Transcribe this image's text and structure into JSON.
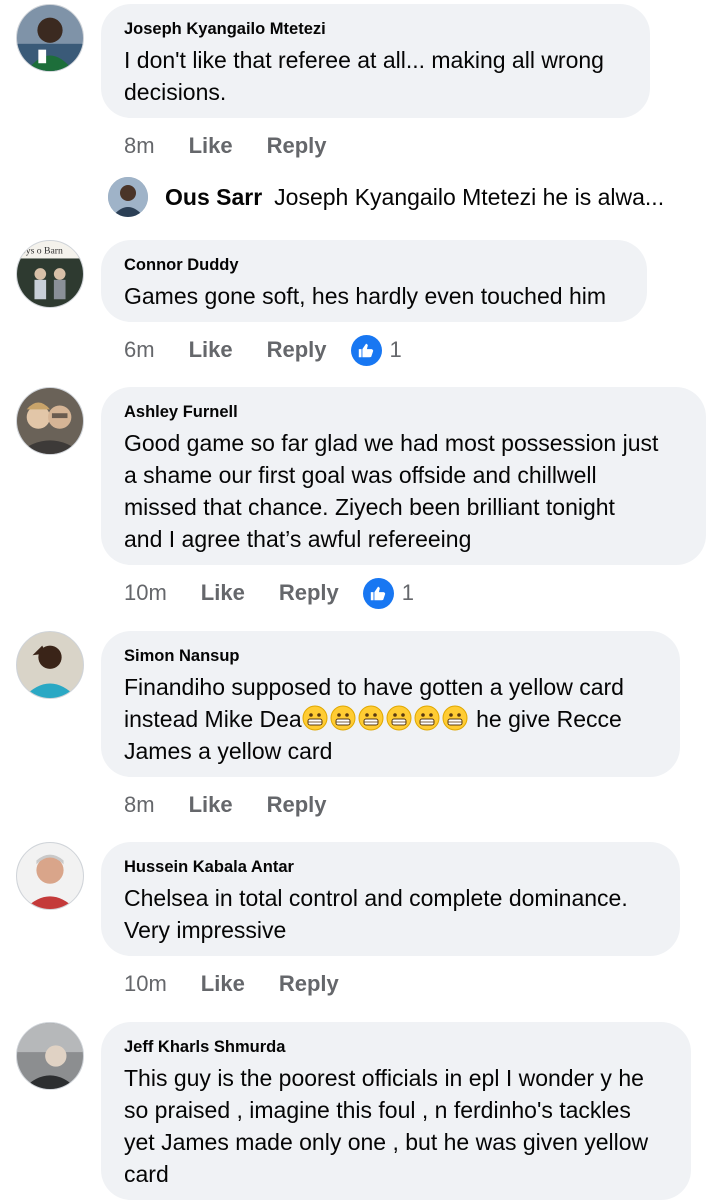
{
  "colors": {
    "bubble": "#f0f2f5",
    "meta_text": "#65676b",
    "like_reaction": "#1877f2"
  },
  "comments": [
    {
      "author": "Joseph Kyangailo Mtetezi",
      "lines": [
        "I don't like that referee at all... making all wrong",
        "decisions."
      ],
      "time": "8m",
      "like_label": "Like",
      "reply_label": "Reply",
      "avatar_icon": "profile-photo-icon"
    },
    {
      "author": "Connor Duddy",
      "lines": [
        "Games gone soft, hes hardly even touched him"
      ],
      "time": "6m",
      "like_label": "Like",
      "reply_label": "Reply",
      "reaction_count": "1",
      "avatar_icon": "profile-photo-icon",
      "avatar_text": "oys o Barn"
    },
    {
      "author": "Ashley Furnell",
      "lines": [
        "Good game so far glad we had most possession just",
        "a shame our first goal was offside and chillwell",
        "missed that chance. Ziyech been brilliant tonight",
        "and I agree that’s awful refereeing"
      ],
      "time": "10m",
      "like_label": "Like",
      "reply_label": "Reply",
      "reaction_count": "1",
      "avatar_icon": "profile-photo-icon"
    },
    {
      "author": "Simon Nansup",
      "lines": [
        "Finandiho supposed to have gotten a yellow card",
        "instead Mike Dea",
        "he give Recce",
        "James a yellow card"
      ],
      "emoji_count": 6,
      "emoji_icon": "grimacing-face-emoji-icon",
      "time": "8m",
      "like_label": "Like",
      "reply_label": "Reply",
      "avatar_icon": "profile-photo-icon"
    },
    {
      "author": "Hussein Kabala Antar",
      "lines": [
        "Chelsea in total control and complete dominance.",
        "Very impressive"
      ],
      "time": "10m",
      "like_label": "Like",
      "reply_label": "Reply",
      "avatar_icon": "profile-photo-icon"
    },
    {
      "author": "Jeff Kharls Shmurda",
      "lines": [
        "This guy is the poorest officials in epl I wonder y he",
        "so praised , imagine this foul , n ferdinho's tackles",
        "yet James made only one , but he was given yellow",
        "card"
      ],
      "avatar_icon": "profile-photo-icon"
    }
  ],
  "reply_preview": {
    "author": "Ous Sarr",
    "text": "Joseph Kyangailo Mtetezi he is alwa..."
  }
}
